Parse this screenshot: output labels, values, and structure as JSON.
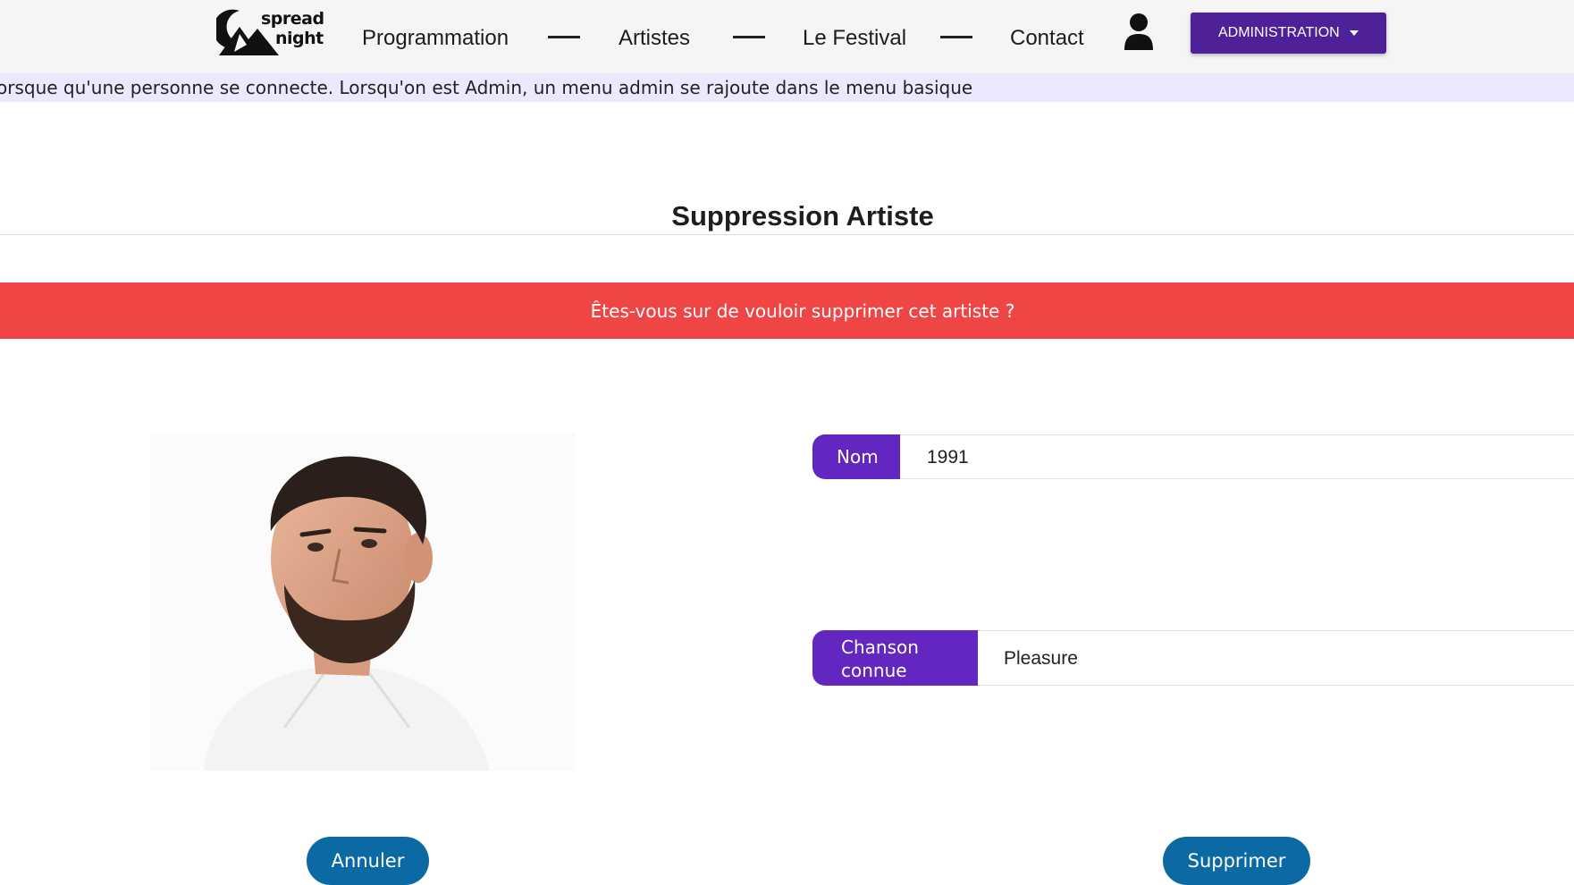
{
  "header": {
    "logo": {
      "line1": "spread",
      "line2": "night"
    },
    "nav": [
      "Programmation",
      "Artistes",
      "Le Festival",
      "Contact"
    ],
    "user_icon": "user-icon",
    "admin_label": "ADMINISTRATION"
  },
  "banner": {
    "text": "orsque qu'une personne se connecte. Lorsqu'on est Admin, un menu admin se rajoute dans le menu basique"
  },
  "page": {
    "title": "Suppression Artiste"
  },
  "alert": {
    "text": "Êtes-vous sur de vouloir supprimer cet artiste ?"
  },
  "artist": {
    "nom_label": "Nom",
    "nom_value": "1991",
    "song_label_line1": "Chanson",
    "song_label_line2": "connue",
    "song_value": "Pleasure"
  },
  "actions": {
    "cancel": "Annuler",
    "delete": "Supprimer"
  },
  "colors": {
    "admin": "#4f2198",
    "label": "#6326c1",
    "alert": "#ef4545",
    "button": "#0b6aa3",
    "banner": "#ebe9fd"
  }
}
